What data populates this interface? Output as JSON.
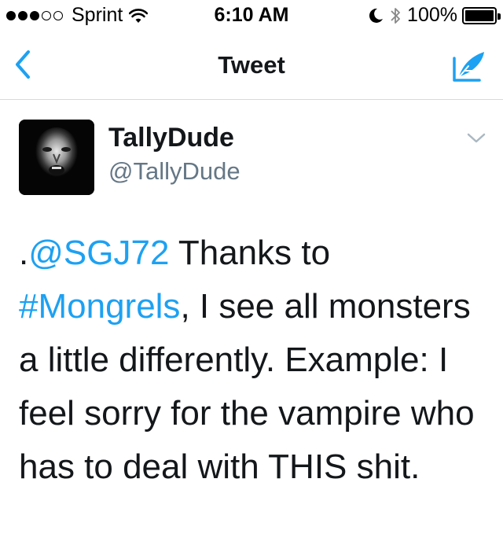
{
  "status_bar": {
    "carrier": "Sprint",
    "time": "6:10 AM",
    "battery_percent": "100%",
    "signal_bars_filled": 3,
    "signal_bars_total": 5,
    "icons": [
      "wifi-icon",
      "moon-icon",
      "bluetooth-icon",
      "battery-icon"
    ]
  },
  "nav": {
    "title": "Tweet",
    "back_icon": "chevron-left-icon",
    "compose_icon": "compose-feather-icon"
  },
  "tweet": {
    "display_name": "TallyDude",
    "handle": "@TallyDude",
    "text": {
      "prefix": ".",
      "mention": "@SGJ72",
      "part1": " Thanks to ",
      "hashtag": "#Mongrels",
      "part2": ", I see all monsters a little differently. Example: I feel sorry for the vampire who has to deal with THIS shit."
    },
    "menu_icon": "chevron-down-icon"
  },
  "colors": {
    "accent": "#1da1f2",
    "text": "#14171a",
    "secondary": "#657786",
    "divider": "#d9d9d9"
  }
}
